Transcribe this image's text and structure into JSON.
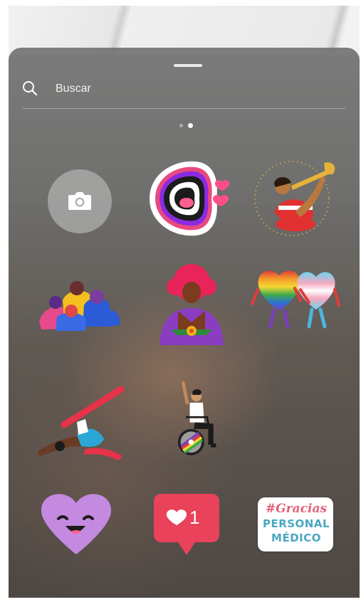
{
  "search": {
    "placeholder": "Buscar"
  },
  "pagination": {
    "total": 2,
    "current": 2
  },
  "stickers": {
    "likes_count": "1",
    "gracias_line1": "#Gracias",
    "gracias_line2": "PERSONAL",
    "gracias_line3": "MÉDICO"
  },
  "colors": {
    "accent_like": "#e9425a",
    "heart_purple": "#c38ae0",
    "gracias_teal": "#4aa7c1",
    "gracias_pink": "#e2607a"
  }
}
